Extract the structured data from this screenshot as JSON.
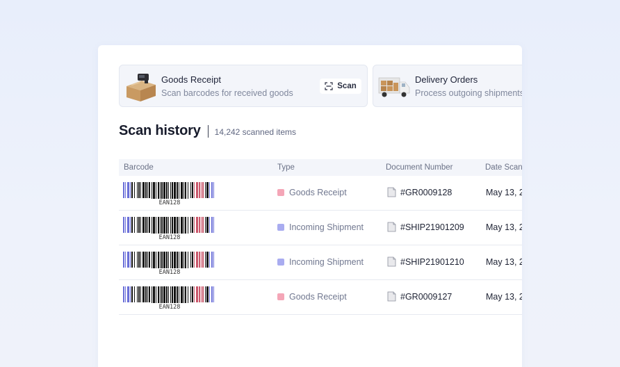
{
  "cards": [
    {
      "title": "Goods Receipt",
      "subtitle": "Scan barcodes for received goods",
      "button_label": "Scan",
      "image": "cardboard-box-with-scanner"
    },
    {
      "title": "Delivery Orders",
      "subtitle": "Process outgoing shipments",
      "image": "delivery-truck"
    }
  ],
  "history": {
    "title": "Scan history",
    "count": "14,242 scanned items"
  },
  "table": {
    "headers": {
      "barcode": "Barcode",
      "type": "Type",
      "document": "Document Number",
      "date": "Date Scan"
    },
    "rows": [
      {
        "barcode_label": "EAN128",
        "type": "Goods Receipt",
        "type_color": "#f4a6b7",
        "document": "#GR0009128",
        "date": "May 13, 2"
      },
      {
        "barcode_label": "EAN128",
        "type": "Incoming Shipment",
        "type_color": "#a9acf0",
        "document": "#SHIP21901209",
        "date": "May 13, 2"
      },
      {
        "barcode_label": "EAN128",
        "type": "Incoming Shipment",
        "type_color": "#a9acf0",
        "document": "#SHIP21901210",
        "date": "May 13, 2"
      },
      {
        "barcode_label": "EAN128",
        "type": "Goods Receipt",
        "type_color": "#f4a6b7",
        "document": "#GR0009127",
        "date": "May 13, 2"
      }
    ]
  },
  "colors": {
    "barcode_blue": "#6a6fd8",
    "barcode_red": "#c9566a",
    "barcode_black": "#111111"
  }
}
